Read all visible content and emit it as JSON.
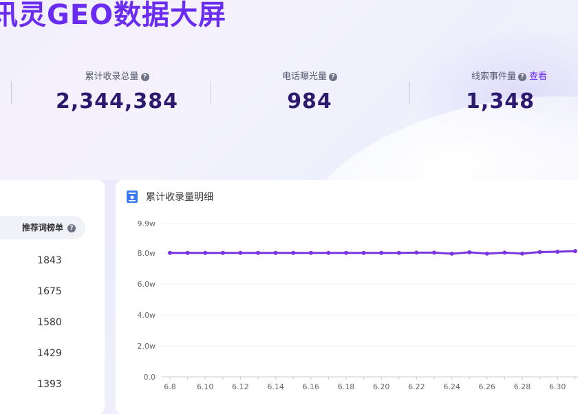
{
  "title": "讯灵GEO数据大屏",
  "stats": [
    {
      "label": "累计收录总量",
      "value": "2,344,384"
    },
    {
      "label": "电话曝光量",
      "value": "984"
    },
    {
      "label": "线索事件量",
      "value": "1,348",
      "link": "查看"
    }
  ],
  "help_glyph": "?",
  "ranking": {
    "tab_label": "推荐词榜单",
    "values": [
      "1843",
      "1675",
      "1580",
      "1429",
      "1393"
    ]
  },
  "chart_panel": {
    "title": "累计收录量明细",
    "icon": "document-icon"
  },
  "chart_data": {
    "type": "line",
    "title": "累计收录量明细",
    "y_tick_labels": [
      "0.0",
      "2.0w",
      "4.0w",
      "6.0w",
      "8.0w",
      "9.9w"
    ],
    "y_ticks": [
      0,
      20000,
      40000,
      60000,
      80000,
      99000
    ],
    "ylim": [
      0,
      99000
    ],
    "x_tick_labels": [
      "6.8",
      "6.10",
      "6.12",
      "6.14",
      "6.16",
      "6.18",
      "6.20",
      "6.22",
      "6.24",
      "6.26",
      "6.28",
      "6.30"
    ],
    "x": [
      "6.8",
      "6.9",
      "6.10",
      "6.11",
      "6.12",
      "6.13",
      "6.14",
      "6.15",
      "6.16",
      "6.17",
      "6.18",
      "6.19",
      "6.20",
      "6.21",
      "6.22",
      "6.23",
      "6.24",
      "6.25",
      "6.26",
      "6.27",
      "6.28",
      "6.29",
      "6.30",
      "7.1"
    ],
    "series": [
      {
        "values": [
          80000,
          80000,
          80000,
          80000,
          80000,
          80000,
          80000,
          80000,
          80000,
          80000,
          80000,
          80000,
          80000,
          80000,
          80200,
          80200,
          79500,
          80400,
          79600,
          80200,
          79600,
          80600,
          80800,
          81200
        ],
        "color": "#7b35e0"
      }
    ],
    "grid": true
  },
  "colors": {
    "accent": "#6a2cf0",
    "value_text": "#2d1a6e",
    "line": "#7b35e0"
  }
}
